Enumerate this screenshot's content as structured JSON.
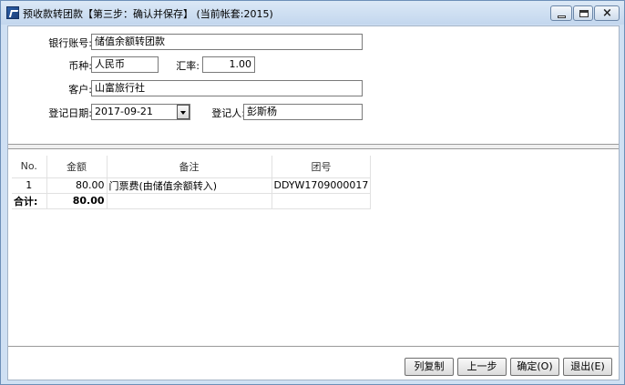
{
  "window": {
    "title": "预收款转团款【第三步：确认并保存】 (当前帐套:2015)"
  },
  "form": {
    "bank_account_label": "银行账号:",
    "bank_account_value": "储值余额转团款",
    "currency_label": "币种:",
    "currency_value": "人民币",
    "rate_label": "汇率:",
    "rate_value": "1.00",
    "customer_label": "客户:",
    "customer_value": "山富旅行社",
    "date_label": "登记日期:",
    "date_value": "2017-09-21",
    "registrant_label": "登记人:",
    "registrant_value": "彭斯杨"
  },
  "grid": {
    "columns": [
      "No.",
      "金额",
      "备注",
      "团号"
    ],
    "rows": [
      {
        "no": "1",
        "amount": "80.00",
        "note": "门票费(由储值余额转入)",
        "group_no": "DDYW1709000017"
      }
    ],
    "total": {
      "label": "合计:",
      "amount": "80.00"
    }
  },
  "buttons": {
    "copy_label": "列复制",
    "prev_label": "上一步",
    "ok_label": "确定(O)",
    "exit_label": "退出(E)"
  },
  "icons": {
    "app": "app-icon",
    "minimize": "minimize-icon",
    "maximize": "maximize-icon",
    "close": "close-icon",
    "dropdown": "chevron-down-icon"
  }
}
